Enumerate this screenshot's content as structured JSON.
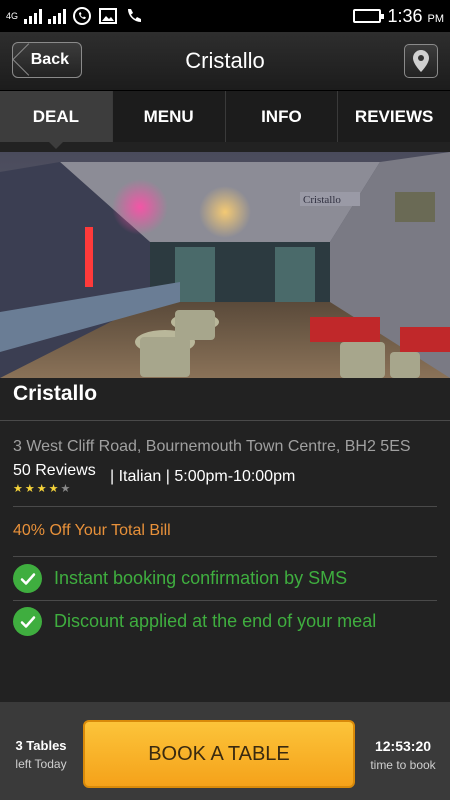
{
  "status_bar": {
    "network": "4G",
    "time": "1:36",
    "ampm": "PM",
    "icons": [
      "signal-icon",
      "signal-icon",
      "whatsapp-icon",
      "image-icon",
      "phone-icon",
      "battery-icon"
    ]
  },
  "header": {
    "back_label": "Back",
    "title": "Cristallo",
    "location_icon": "location-pin-icon"
  },
  "tabs": [
    {
      "label": "DEAL",
      "active": true
    },
    {
      "label": "MENU",
      "active": false
    },
    {
      "label": "INFO",
      "active": false
    },
    {
      "label": "REVIEWS",
      "active": false
    }
  ],
  "restaurant": {
    "name": "Cristallo",
    "address": "3 West Cliff Road, Bournemouth Town Centre, BH2 5ES",
    "reviews_label": "50 Reviews",
    "rating": 4,
    "rating_max": 5,
    "meta": "| Italian | 5:00pm-10:00pm",
    "hero_sign_text": "Cristallo"
  },
  "deal": {
    "offer": "40% Off Your Total Bill",
    "features": [
      "Instant booking confirmation by SMS",
      "Discount applied at the end of your meal"
    ]
  },
  "booking": {
    "tables_count": "3 Tables",
    "tables_sub": "left Today",
    "button_label": "BOOK A TABLE",
    "timer": "12:53:20",
    "timer_sub": "time to book"
  },
  "colors": {
    "accent_green": "#3fae3f",
    "offer_orange": "#e8913a",
    "button_yellow": "#fcc43a",
    "star_yellow": "#f5d33a"
  }
}
